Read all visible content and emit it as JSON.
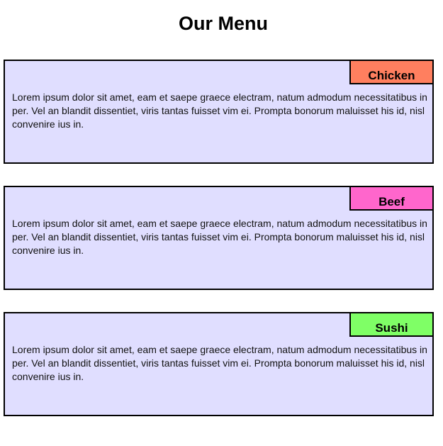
{
  "page": {
    "title": "Our Menu"
  },
  "menu": {
    "items": [
      {
        "name": "Chicken",
        "description": "Lorem ipsum dolor sit amet, eam et saepe graece electram, natum admodum necessitatibus in per. Vel an blandit dissentiet, viris tantas fuisset vim ei. Prompta bonorum maluisset his id, nisl convenire ius in.",
        "tag_color": "#ff7f5f"
      },
      {
        "name": "Beef",
        "description": "Lorem ipsum dolor sit amet, eam et saepe graece electram, natum admodum necessitatibus in per. Vel an blandit dissentiet, viris tantas fuisset vim ei. Prompta bonorum maluisset his id, nisl convenire ius in.",
        "tag_color": "#ff66cc"
      },
      {
        "name": "Sushi",
        "description": "Lorem ipsum dolor sit amet, eam et saepe graece electram, natum admodum necessitatibus in per. Vel an blandit dissentiet, viris tantas fuisset vim ei. Prompta bonorum maluisset his id, nisl convenire ius in.",
        "tag_color": "#7fff66"
      }
    ],
    "card_background": "#e0deff"
  }
}
